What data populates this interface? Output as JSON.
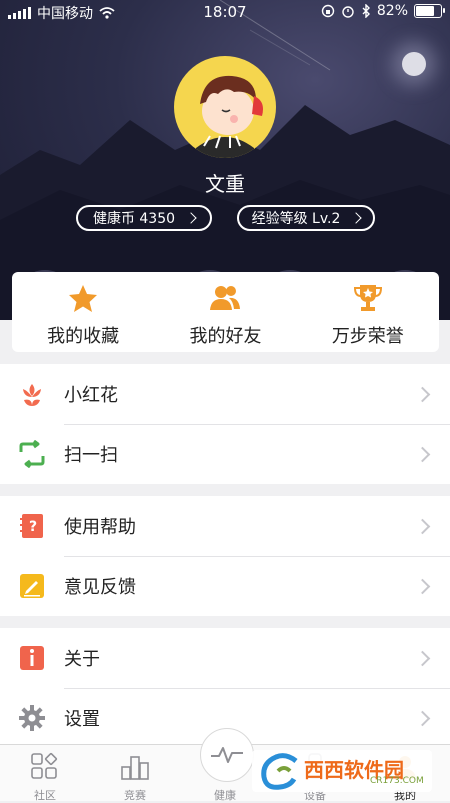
{
  "status_bar": {
    "carrier": "中国移动",
    "time": "18:07",
    "battery_percent": 82,
    "battery_text": "82%"
  },
  "profile": {
    "name": "文重",
    "coins_label": "健康币 4350",
    "level_label": "经验等级 Lv.2"
  },
  "quick_actions": [
    {
      "label": "我的收藏",
      "icon": "star-icon"
    },
    {
      "label": "我的好友",
      "icon": "friends-icon"
    },
    {
      "label": "万步荣誉",
      "icon": "trophy-icon"
    }
  ],
  "menu": {
    "flower": "小红花",
    "scan": "扫一扫",
    "help": "使用帮助",
    "feedback": "意见反馈",
    "about": "关于",
    "settings": "设置"
  },
  "tabs": [
    {
      "label": "社区",
      "icon": "community-icon"
    },
    {
      "label": "竞赛",
      "icon": "competition-icon"
    },
    {
      "label": "健康",
      "icon": "health-pulse-icon"
    },
    {
      "label": "设备",
      "icon": "device-icon"
    },
    {
      "label": "我的",
      "icon": "me-icon"
    }
  ],
  "watermark": {
    "text": "西西软件园",
    "sub": "CR173.COM"
  },
  "colors": {
    "accent_orange": "#f19a2b",
    "flower_red": "#f26b4f",
    "scan_green": "#4caf50",
    "help_red": "#f0644c",
    "feedback_yellow": "#f5b91c",
    "about_red": "#f0644c",
    "settings_gray": "#8e8e93"
  }
}
